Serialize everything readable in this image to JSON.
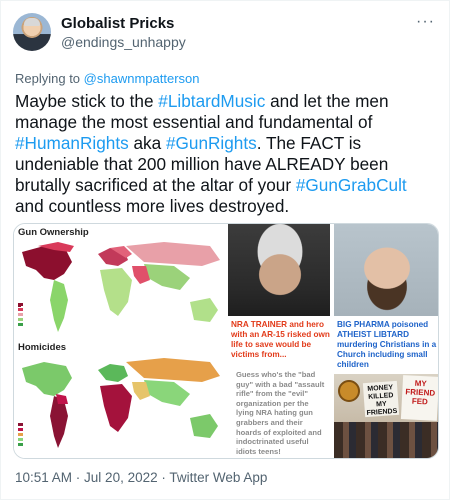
{
  "author": {
    "name": "Globalist Pricks",
    "handle": "@endings_unhappy"
  },
  "reply": {
    "prefix": "Replying to",
    "to": "@shawnmpatterson"
  },
  "tweet": {
    "text_1": "Maybe stick to the ",
    "tag_1": "#LibtardMusic",
    "text_2": " and let the men manage the most essential and fundamental of ",
    "tag_2": "#HumanRights",
    "text_3": " aka ",
    "tag_3": "#GunRights",
    "text_4": ".  The FACT is undeniable that 200 million have ALREADY been brutally sacrificed at the altar of your ",
    "tag_4": "#GunGrabCult",
    "text_5": " and countless more lives destroyed."
  },
  "media": {
    "map1_title": "Gun Ownership",
    "map2_title": "Homicides",
    "caption_left": "NRA TRAINER and hero with an AR-15 risked own life to save would be victims from...",
    "caption_right": "BIG PHARMA poisoned ATHEIST LIBTARD murdering Christians in a Church including small children",
    "guess_text": "Guess who's the \"bad guy\" with a bad \"assault rifle\" from the \"evil\" organization per the lying NRA hating gun grabbers and their hoards of exploited and indoctrinated useful idiots teens!",
    "sign1_text": "MONEY KILLED MY FRIENDS",
    "sign2_text": "MY FRIEND FED"
  },
  "footer": {
    "time": "10:51 AM",
    "sep1": " · ",
    "date": "Jul 20, 2022",
    "sep2": " · ",
    "app": "Twitter Web App"
  },
  "colors": {
    "link": "#1d9bf0",
    "muted": "#536471",
    "caption_red": "#e23b1a",
    "caption_blue": "#1e63c9"
  }
}
